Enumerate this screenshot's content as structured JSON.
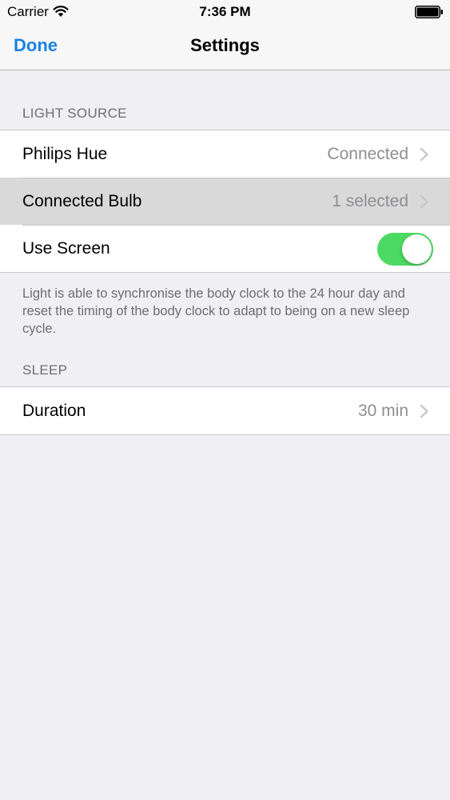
{
  "status_bar": {
    "carrier": "Carrier",
    "time": "7:36 PM",
    "wifi_icon": "wifi-icon",
    "battery_icon": "battery-icon"
  },
  "nav_bar": {
    "done_label": "Done",
    "title": "Settings"
  },
  "sections": {
    "light_source": {
      "header": "LIGHT SOURCE",
      "rows": {
        "philips_hue": {
          "label": "Philips Hue",
          "value": "Connected"
        },
        "connected_bulb": {
          "label": "Connected Bulb",
          "value": "1 selected"
        },
        "use_screen": {
          "label": "Use Screen",
          "toggle_on": true
        }
      },
      "footer": "Light is able to synchronise the body clock to the 24 hour day and reset the timing of the body clock to adapt to being on a new sleep cycle."
    },
    "sleep": {
      "header": "SLEEP",
      "rows": {
        "duration": {
          "label": "Duration",
          "value": "30 min"
        }
      }
    }
  },
  "colors": {
    "tint": "#1a82e2",
    "toggle_on": "#4cd964",
    "background": "#efeff4",
    "highlight": "#d9d9d9"
  }
}
